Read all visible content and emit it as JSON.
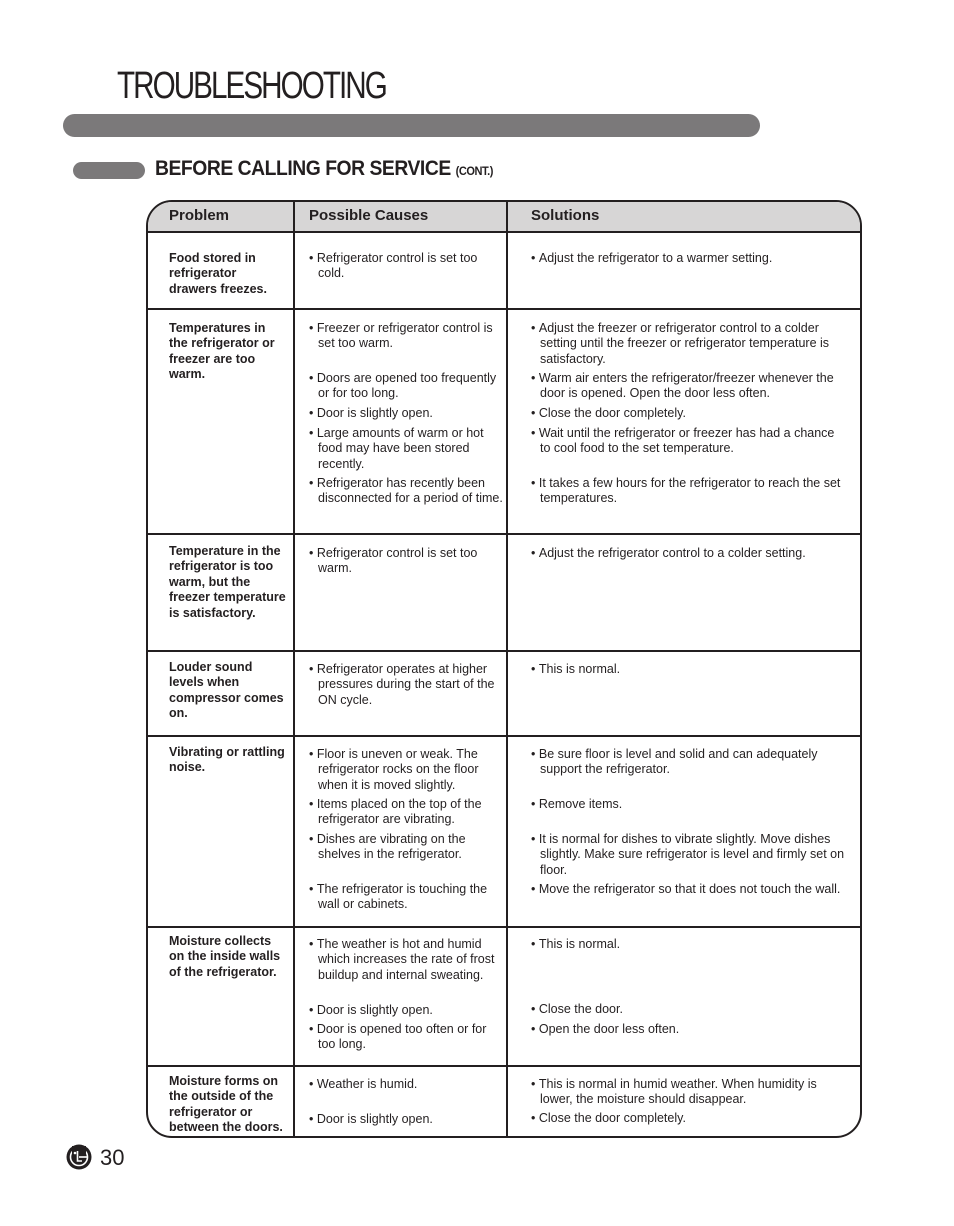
{
  "header": {
    "title": "TROUBLESHOOTING",
    "section_title": "BEFORE CALLING FOR SERVICE",
    "section_suffix": "(CONT.)"
  },
  "table": {
    "columns": [
      "Problem",
      "Possible Causes",
      "Solutions"
    ],
    "rows": [
      {
        "problem": "Food stored in refrigerator drawers freezes.",
        "causes": [
          "Refrigerator control is set too cold."
        ],
        "solutions": [
          "Adjust the refrigerator to a warmer setting."
        ]
      },
      {
        "problem": "Temperatures in the refrigerator or freezer are too warm.",
        "causes": [
          "Freezer or refrigerator control is set too warm.",
          "Doors are opened too frequently or for too long.",
          "Door is slightly open.",
          "Large amounts of warm or hot food may have been stored recently.",
          "Refrigerator has recently been disconnected for a period of time."
        ],
        "solutions": [
          "Adjust the freezer or refrigerator control to a colder setting until the freezer or refrigerator temperature is satisfactory.",
          "Warm air enters the refrigerator/freezer whenever the door is opened. Open the door less often.",
          "Close the door completely.",
          "Wait until the refrigerator or freezer has had a chance to cool food to the set temperature.",
          "It takes a few hours for the refrigerator to reach the set temperatures."
        ]
      },
      {
        "problem": "Temperature in the refrigerator is too warm, but the freezer temperature is satisfactory.",
        "causes": [
          "Refrigerator control is set too warm."
        ],
        "solutions": [
          "Adjust the refrigerator control to a colder setting."
        ]
      },
      {
        "problem": "Louder sound levels when compressor comes on.",
        "causes": [
          "Refrigerator operates at higher pressures during the start of the ON cycle."
        ],
        "solutions": [
          "This is normal."
        ]
      },
      {
        "problem": "Vibrating or rattling noise.",
        "causes": [
          "Floor is uneven or weak. The refrigerator rocks on the floor when it is moved slightly.",
          "Items placed on the top of the refrigerator are vibrating.",
          "Dishes are vibrating on the shelves in the refrigerator.",
          "The refrigerator is touching the wall or cabinets."
        ],
        "solutions": [
          "Be sure floor is level and solid and can adequately support the refrigerator.",
          "Remove items.",
          "It is normal for dishes to vibrate slightly. Move dishes slightly. Make sure refrigerator is level and firmly set on floor.",
          "Move the refrigerator so that it does not touch the wall."
        ]
      },
      {
        "problem": "Moisture collects on the inside walls of the refrigerator.",
        "causes": [
          "The weather is hot and humid which increases the rate of frost buildup and internal sweating.",
          "Door is slightly open.",
          "Door is opened too often or for too long."
        ],
        "solutions": [
          "This is normal.",
          "Close the door.",
          "Open the door less often."
        ]
      },
      {
        "problem": "Moisture forms on the outside of the refrigerator or between the doors.",
        "causes": [
          "Weather is humid.",
          "Door is slightly open."
        ],
        "solutions": [
          "This is normal in humid weather. When humidity is lower, the moisture should disappear.",
          "Close the door completely."
        ]
      }
    ]
  },
  "footer": {
    "logo": "lg-logo-icon",
    "page_number": "30"
  }
}
